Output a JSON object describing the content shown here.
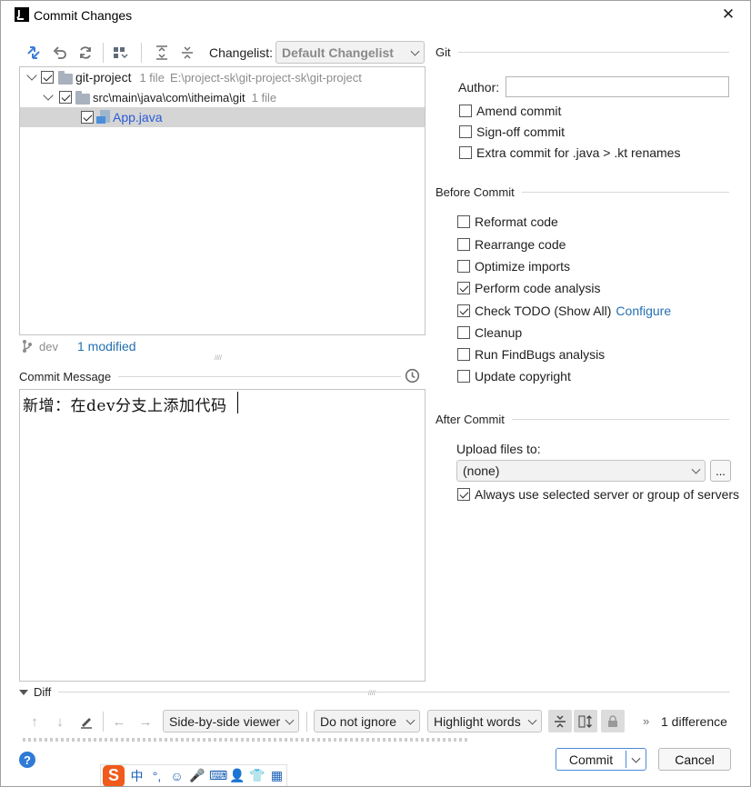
{
  "window": {
    "title": "Commit Changes",
    "close_glyph": "✕"
  },
  "toolbar": {
    "icons": [
      "diff-arrows-icon",
      "undo-icon",
      "refresh-icon",
      "group-by-icon",
      "expand-all-icon",
      "collapse-all-icon"
    ],
    "changelist_label": "Changelist:",
    "changelist_value": "Default Changelist"
  },
  "tree": {
    "rows": [
      {
        "name": "git-project",
        "count": "1 file",
        "path": "E:\\project-sk\\git-project-sk\\git-project"
      },
      {
        "name": "src\\main\\java\\com\\itheima\\git",
        "count": "1 file"
      },
      {
        "name": "App.java"
      }
    ]
  },
  "status": {
    "branch": "dev",
    "modified": "1 modified",
    "splitter_grip": "////"
  },
  "commit_message": {
    "label": "Commit Message",
    "text": "新增：在dev分支上添加代码"
  },
  "git": {
    "section": "Git",
    "author_label": "Author:",
    "author_value": "",
    "amend": "Amend commit",
    "signoff": "Sign-off commit",
    "extra": "Extra commit for .java > .kt renames"
  },
  "before_commit": {
    "section": "Before Commit",
    "options": [
      {
        "label": "Reformat code",
        "checked": false
      },
      {
        "label": "Rearrange code",
        "checked": false
      },
      {
        "label": "Optimize imports",
        "checked": false
      },
      {
        "label": "Perform code analysis",
        "checked": true
      },
      {
        "label": "Check TODO (Show All)",
        "checked": true,
        "link": "Configure"
      },
      {
        "label": "Cleanup",
        "checked": false
      },
      {
        "label": "Run FindBugs analysis",
        "checked": false
      },
      {
        "label": "Update copyright",
        "checked": false
      }
    ]
  },
  "after_commit": {
    "section": "After Commit",
    "upload_label": "Upload files to:",
    "upload_value": "(none)",
    "browse_label": "...",
    "always_use": "Always use selected server or group of servers"
  },
  "diff": {
    "label": "Diff",
    "viewer": "Side-by-side viewer",
    "ignore": "Do not ignore",
    "highlight": "Highlight words",
    "differences": "1 difference",
    "splitter_grip": "////"
  },
  "buttons": {
    "commit": "Commit",
    "cancel": "Cancel",
    "help": "?"
  },
  "ime": {
    "logo": "S",
    "items": [
      "中",
      "°,",
      "☺",
      "🎤",
      "⌨",
      "👤",
      "👕",
      "▦"
    ]
  },
  "colors": {
    "accent": "#2470b3",
    "selection": "#d5d5d5",
    "ime": "#f05a1a"
  }
}
